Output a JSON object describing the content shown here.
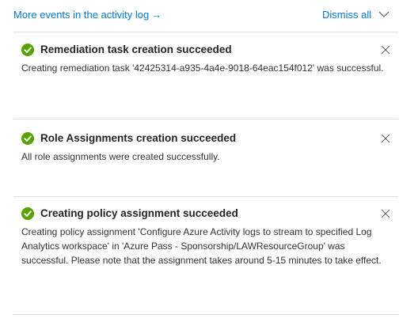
{
  "header": {
    "activity_link": "More events in the activity log",
    "activity_link_arrow": "→",
    "dismiss_all": "Dismiss all"
  },
  "notifications": [
    {
      "title": "Remediation task creation succeeded",
      "message": "Creating remediation task '42425314-a935-4a4e-9018-64eac154f012' was successful.",
      "status": "success"
    },
    {
      "title": "Role Assignments creation succeeded",
      "message": "All role assignments were created successfully.",
      "status": "success"
    },
    {
      "title": "Creating policy assignment succeeded",
      "message": "Creating policy assignment 'Configure Azure Activity logs to stream to specified Log Analytics workspace' in 'Azure Pass - Sponsorship/LAWResourceGroup' was successful. Please note that the assignment takes around 5-15 minutes to take effect.",
      "status": "success"
    }
  ],
  "colors": {
    "accent": "#0078d4",
    "success": "#57a300",
    "divider": "#e1dfdd",
    "text": "#323130"
  },
  "icons": {
    "status": "checkmark-circle-icon",
    "close": "close-icon",
    "dismiss_chevron": "chevron-down-icon"
  }
}
